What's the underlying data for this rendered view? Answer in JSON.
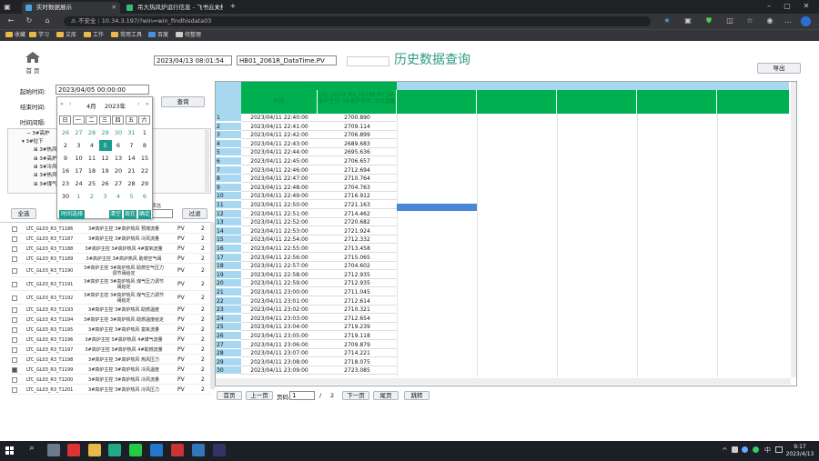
{
  "browser": {
    "tab1": "实时数据展示",
    "tab2": "吊大热风炉运行信息 - 飞书云文档",
    "insecure": "不安全",
    "url": "10.34.3.197/?win=win_findhisdata03",
    "bookmarks": [
      "收藏",
      "学习",
      "文库",
      "工作",
      "常用工具",
      "百度",
      "待整理"
    ]
  },
  "sidebar": {
    "home_label": "首 页"
  },
  "header": {
    "time_value": "2023/04/13 08:01:54",
    "tag_value": "HB01_2061R_DataTime.PV",
    "title": "历史数据查询",
    "export_label": "导出"
  },
  "query": {
    "start_label": "起始时间:",
    "start_value": "2023/04/05 00:00:00",
    "end_label": "结束时间:",
    "interval_label": "时间间隔:",
    "query_label": "查询",
    "select_all_label": "全选",
    "filter_label": "过滤",
    "filter_hint": "筛选"
  },
  "calendar": {
    "month": "4月",
    "year": "2023年",
    "weekdays": [
      "日",
      "一",
      "二",
      "三",
      "四",
      "五",
      "六"
    ],
    "days": [
      "26",
      "27",
      "28",
      "29",
      "30",
      "31",
      "1",
      "2",
      "3",
      "4",
      "5",
      "6",
      "7",
      "8",
      "9",
      "10",
      "11",
      "12",
      "13",
      "14",
      "15",
      "16",
      "17",
      "18",
      "19",
      "20",
      "21",
      "22",
      "23",
      "24",
      "25",
      "26",
      "27",
      "28",
      "29",
      "30",
      "1",
      "2",
      "3",
      "4",
      "5",
      "6"
    ],
    "selected_index": 10,
    "time_button": "时间选择",
    "clear_button": "清空",
    "now_button": "现在",
    "ok_button": "确定"
  },
  "tree": {
    "items": [
      "3#高炉",
      "3#拉下",
      "3#热风炉",
      "3#高炉",
      "3#冷风",
      "3#热风炉",
      "3#煤气"
    ]
  },
  "tag_list": [
    {
      "tag": "LTC_GL03_R3_T1186",
      "desc": "3#高炉主控 3#高炉热风 预煤流量",
      "pv": "PV",
      "n": "2",
      "checked": false
    },
    {
      "tag": "LTC_GL03_R3_T1187",
      "desc": "3#高炉主控 3#高炉热风 冷风流量",
      "pv": "PV",
      "n": "2",
      "checked": false
    },
    {
      "tag": "LTC_GL03_R3_T1188",
      "desc": "3#高炉主控 3#高炉热风 4#富氧流量",
      "pv": "PV",
      "n": "2",
      "checked": false
    },
    {
      "tag": "LTC_GL03_R3_T1189",
      "desc": "3#高炉主控 3#高炉热风 助燃空气阀",
      "pv": "PV",
      "n": "2",
      "checked": false
    },
    {
      "tag": "LTC_GL03_R3_T1190",
      "desc": "3#高炉主控 3#高炉热风 助燃空气压力调节阀给定",
      "pv": "PV",
      "n": "2",
      "checked": false
    },
    {
      "tag": "LTC_GL03_R3_T1191",
      "desc": "3#高炉主控 3#高炉热风 煤气压力调节阀给定",
      "pv": "PV",
      "n": "2",
      "checked": false
    },
    {
      "tag": "LTC_GL03_R3_T1192",
      "desc": "3#高炉主控 3#高炉热风 煤气压力调节阀给定",
      "pv": "PV",
      "n": "2",
      "checked": false
    },
    {
      "tag": "LTC_GL03_R3_T1193",
      "desc": "3#高炉主控 3#高炉热风 助燃温度",
      "pv": "PV",
      "n": "2",
      "checked": false
    },
    {
      "tag": "LTC_GL03_R3_T1194",
      "desc": "3#高炉主控 3#高炉热风 助燃温度给定",
      "pv": "PV",
      "n": "2",
      "checked": false
    },
    {
      "tag": "LTC_GL03_R3_T1195",
      "desc": "3#高炉主控 3#高炉热风 富氧流量",
      "pv": "PV",
      "n": "2",
      "checked": false
    },
    {
      "tag": "LTC_GL03_R3_T1196",
      "desc": "3#高炉主控 3#高炉热风 4#煤气流量",
      "pv": "PV",
      "n": "2",
      "checked": false
    },
    {
      "tag": "LTC_GL03_R3_T1197",
      "desc": "3#高炉主控 3#高炉热风 4#助燃流量",
      "pv": "PV",
      "n": "2",
      "checked": false
    },
    {
      "tag": "LTC_GL03_R3_T1198",
      "desc": "3#高炉主控 3#高炉热风 热风压力",
      "pv": "PV",
      "n": "2",
      "checked": false
    },
    {
      "tag": "LTC_GL03_R3_T1199",
      "desc": "3#高炉主控 3#高炉热风 冷风温度",
      "pv": "PV",
      "n": "2",
      "checked": true
    },
    {
      "tag": "LTC_GL03_R3_T1200",
      "desc": "3#高炉主控 3#高炉热风 冷风流量",
      "pv": "PV",
      "n": "2",
      "checked": false
    },
    {
      "tag": "LTC_GL03_R3_T1201",
      "desc": "3#高炉主控 3#高炉热风 冷风压力",
      "pv": "PV",
      "n": "2",
      "checked": false
    }
  ],
  "table": {
    "time_header": "时间",
    "col_header": "LTC_GL03_R3_T1199.PV 3#高炉主控 3#高炉热风 冷风温度",
    "rows": [
      [
        "1",
        "2023/04/11 22:40:00",
        "2700.890"
      ],
      [
        "2",
        "2023/04/11 22:41:00",
        "2709.114"
      ],
      [
        "3",
        "2023/04/11 22:42:00",
        "2706.899"
      ],
      [
        "4",
        "2023/04/11 22:43:00",
        "2689.683"
      ],
      [
        "5",
        "2023/04/11 22:44:00",
        "2695.636"
      ],
      [
        "6",
        "2023/04/11 22:45:00",
        "2706.657"
      ],
      [
        "7",
        "2023/04/11 22:46:00",
        "2712.694"
      ],
      [
        "8",
        "2023/04/11 22:47:00",
        "2710.764"
      ],
      [
        "9",
        "2023/04/11 22:48:00",
        "2704.763"
      ],
      [
        "10",
        "2023/04/11 22:49:00",
        "2716.912"
      ],
      [
        "11",
        "2023/04/11 22:50:00",
        "2721.163"
      ],
      [
        "12",
        "2023/04/11 22:51:00",
        "2714.462"
      ],
      [
        "13",
        "2023/04/11 22:52:00",
        "2720.682"
      ],
      [
        "14",
        "2023/04/11 22:53:00",
        "2721.924"
      ],
      [
        "15",
        "2023/04/11 22:54:00",
        "2712.332"
      ],
      [
        "16",
        "2023/04/11 22:55:00",
        "2713.458"
      ],
      [
        "17",
        "2023/04/11 22:56:00",
        "2715.065"
      ],
      [
        "18",
        "2023/04/11 22:57:00",
        "2704.602"
      ],
      [
        "19",
        "2023/04/11 22:58:00",
        "2712.935"
      ],
      [
        "20",
        "2023/04/11 22:59:00",
        "2712.935"
      ],
      [
        "21",
        "2023/04/11 23:00:00",
        "2711.045"
      ],
      [
        "22",
        "2023/04/11 23:01:00",
        "2712.614"
      ],
      [
        "23",
        "2023/04/11 23:02:00",
        "2710.321"
      ],
      [
        "24",
        "2023/04/11 23:03:00",
        "2712.654"
      ],
      [
        "25",
        "2023/04/11 23:04:00",
        "2719.239"
      ],
      [
        "26",
        "2023/04/11 23:05:00",
        "2719.118"
      ],
      [
        "27",
        "2023/04/11 23:06:00",
        "2709.879"
      ],
      [
        "28",
        "2023/04/11 23:07:00",
        "2714.221"
      ],
      [
        "29",
        "2023/04/11 23:08:00",
        "2718.075"
      ],
      [
        "30",
        "2023/04/11 23:09:00",
        "2723.085"
      ]
    ]
  },
  "pager": {
    "first": "首页",
    "prev": "上一页",
    "page_label": "页码:",
    "page_value": "1",
    "slash": "/",
    "total": "2",
    "next": "下一页",
    "last": "尾页",
    "goto": "跳转"
  },
  "taskbar": {
    "time": "9:17",
    "date": "2023/4/13",
    "lang": "中"
  }
}
